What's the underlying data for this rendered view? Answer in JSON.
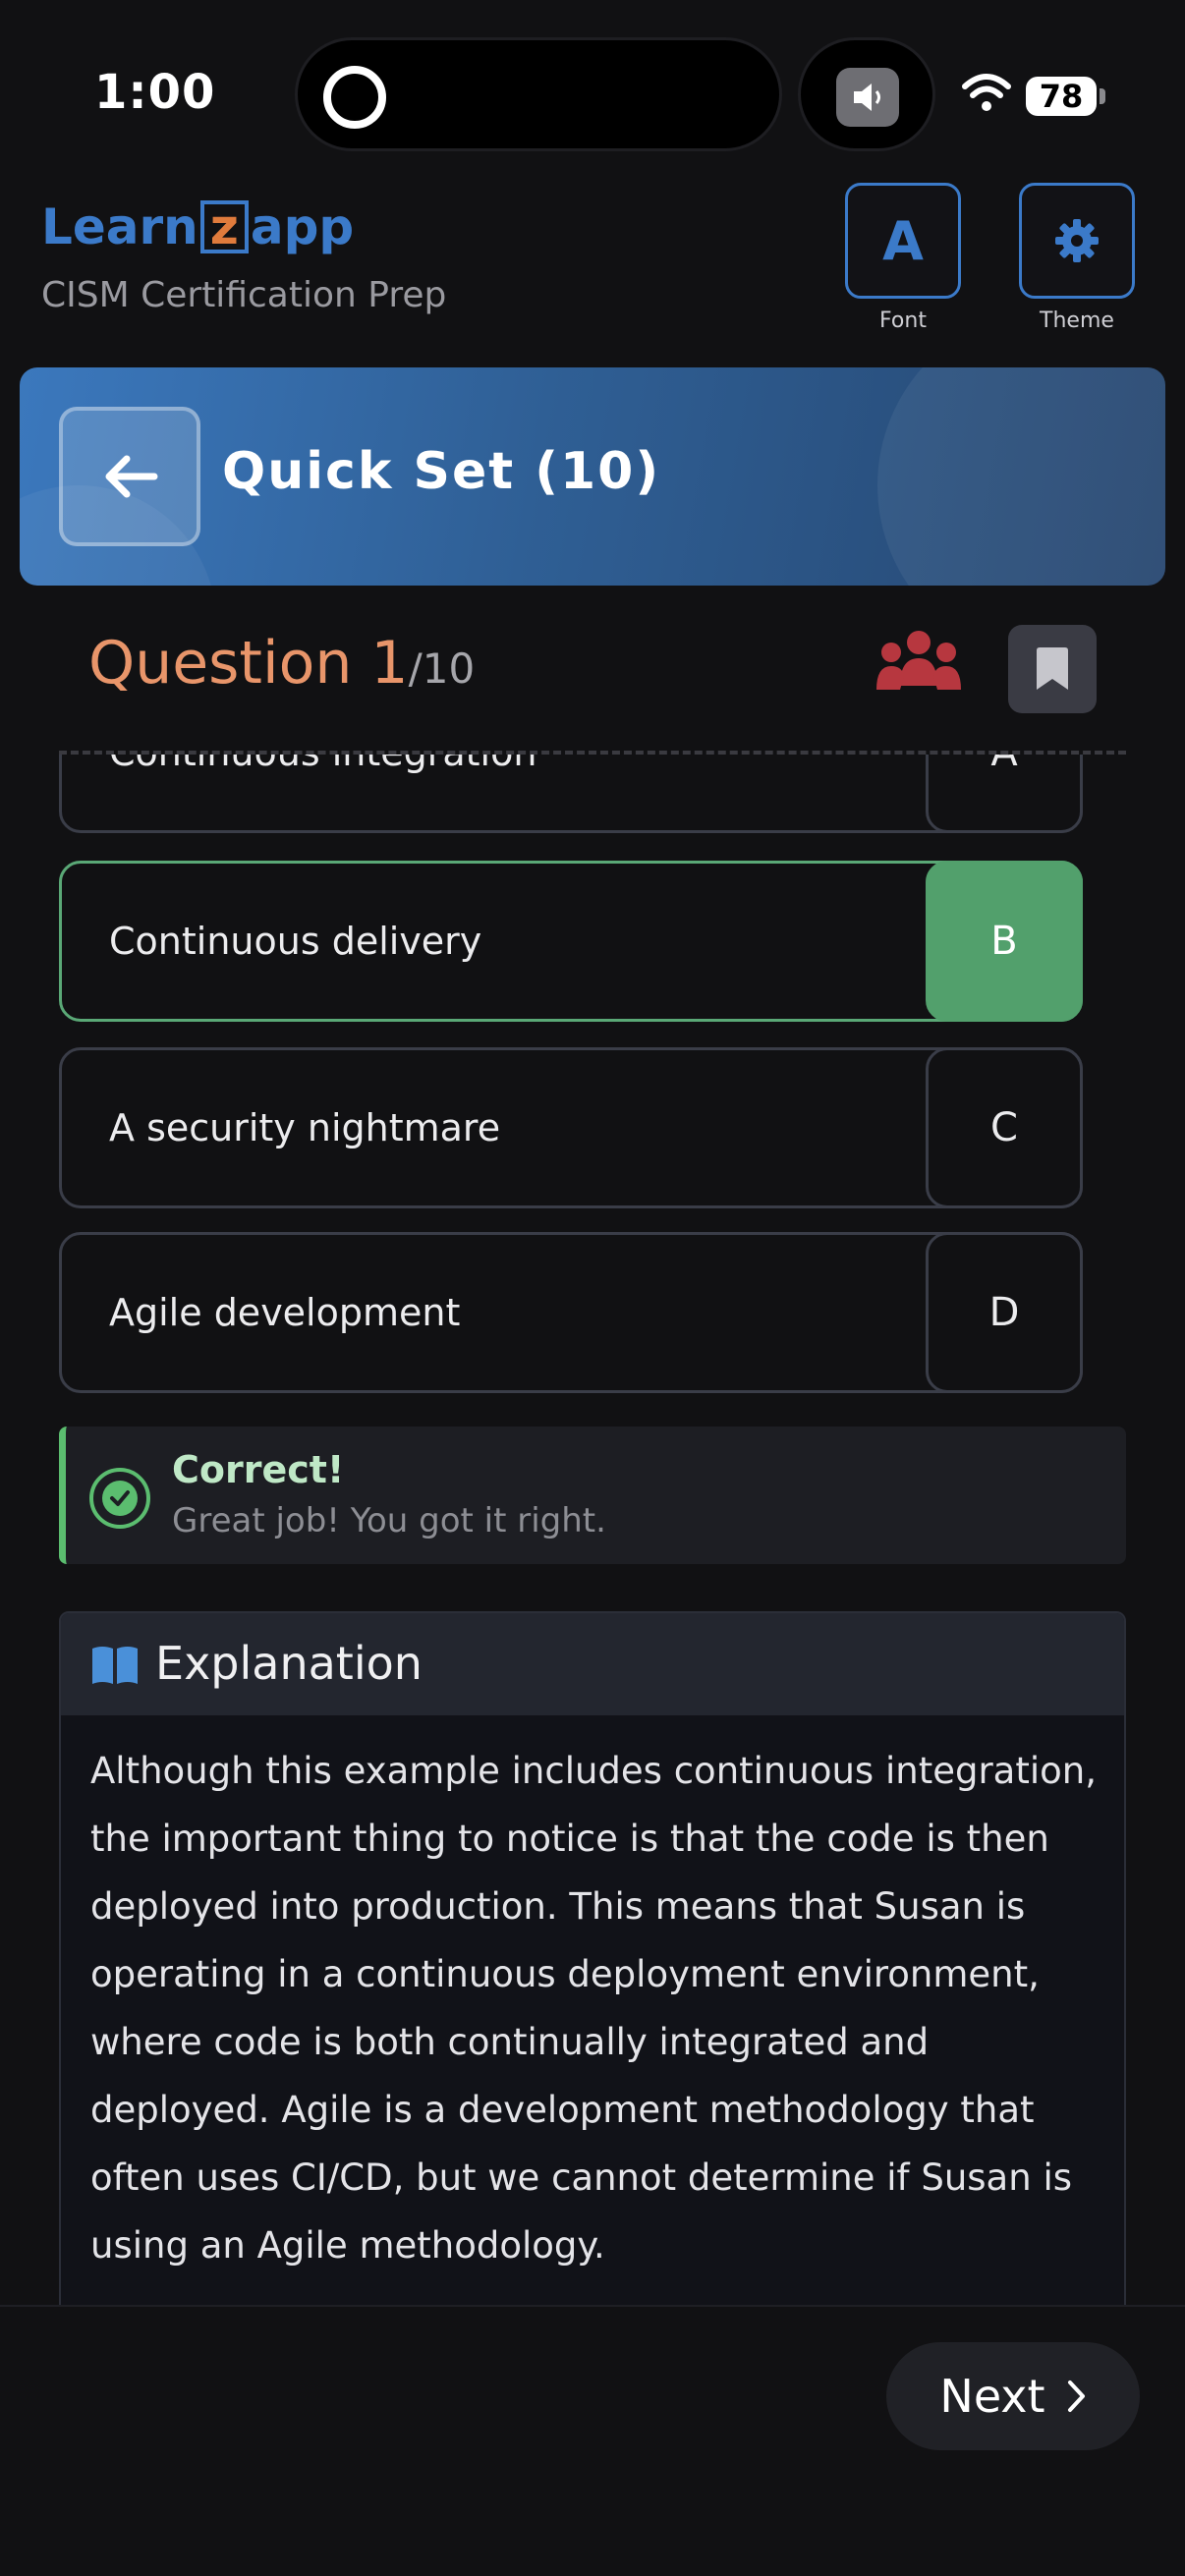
{
  "status_bar": {
    "time": "1:00",
    "battery": "78",
    "icons": [
      "island-icon",
      "volume-icon",
      "wifi-icon",
      "battery-icon"
    ]
  },
  "header": {
    "logo": {
      "part1": "Learn",
      "part2": "z",
      "part3": "app"
    },
    "subtitle": "CISM Certification Prep",
    "font_button": {
      "glyph": "A",
      "label": "Font"
    },
    "theme_button": {
      "label": "Theme",
      "icon": "gear-icon"
    }
  },
  "banner": {
    "title": "Quick Set (10)",
    "back_icon": "arrow-left-icon"
  },
  "question": {
    "label": "Question 1",
    "total": "/10",
    "icons": [
      "group-icon",
      "bookmark-icon"
    ]
  },
  "options": [
    {
      "text": "Continuous integration",
      "letter": "A",
      "state": "default"
    },
    {
      "text": "Continuous delivery",
      "letter": "B",
      "state": "correct"
    },
    {
      "text": "A security nightmare",
      "letter": "C",
      "state": "default"
    },
    {
      "text": "Agile development",
      "letter": "D",
      "state": "default"
    }
  ],
  "feedback": {
    "title": "Correct!",
    "text": "Great job! You got it right."
  },
  "explanation": {
    "title": "Explanation",
    "body": "Although this example includes continuous integration, the important thing to notice is that the code is then deployed into production. This means that Susan is operating in a continuous deployment environment, where code is both continually integrated and deployed. Agile is a development methodology that often uses CI/CD, but we cannot determine if Susan is using an Agile methodology."
  },
  "footer": {
    "next_label": "Next",
    "next_icon": "chevron-right-icon"
  },
  "colors": {
    "background": "#111113",
    "brand_blue": "#3b7ac9",
    "accent_orange": "#e8956a",
    "correct_green": "#52a06c",
    "group_icon_red": "#b7373f"
  }
}
